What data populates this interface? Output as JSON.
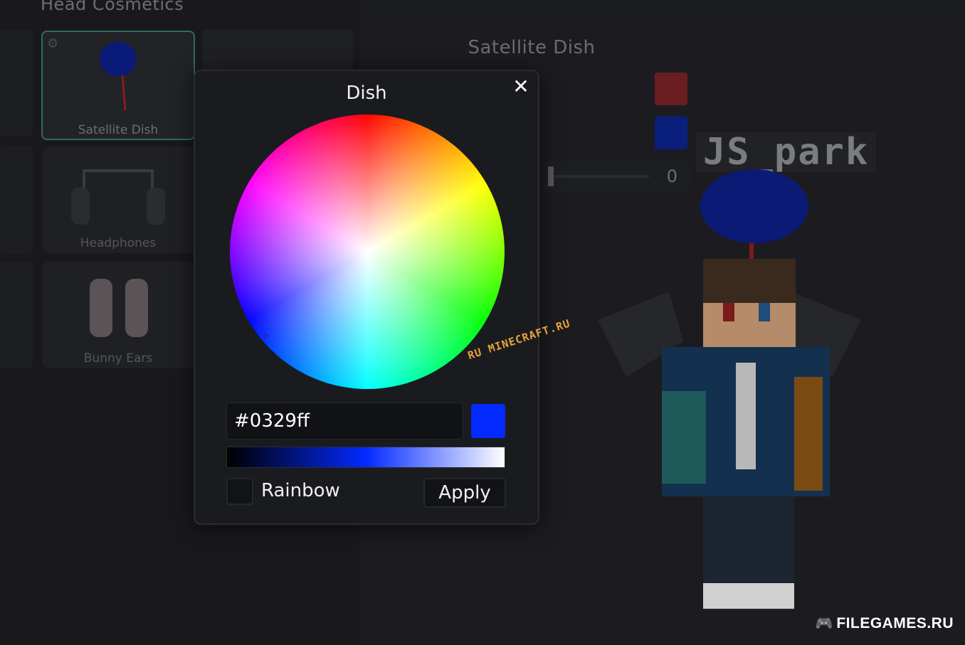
{
  "background": {
    "section_title": "Head Cosmetics",
    "items": [
      {
        "label": "Satellite Dish",
        "selected": true
      },
      {
        "label": "Headphones",
        "selected": false
      },
      {
        "label": "Bunny Ears",
        "selected": false
      }
    ],
    "preview": {
      "title": "Satellite Dish",
      "swatches": [
        "#6a1e22",
        "#0a1f7c"
      ],
      "slider_value": "0",
      "nametag": "JS_park"
    }
  },
  "modal": {
    "title": "Dish",
    "close_label": "✕",
    "hex_value": "#0329ff",
    "selected_color": "#0329ff",
    "rainbow_label": "Rainbow",
    "rainbow_checked": false,
    "apply_label": "Apply"
  },
  "overlays": {
    "watermark": "RU MINECRAFT.RU",
    "brand": "FILEGAMES.RU"
  }
}
